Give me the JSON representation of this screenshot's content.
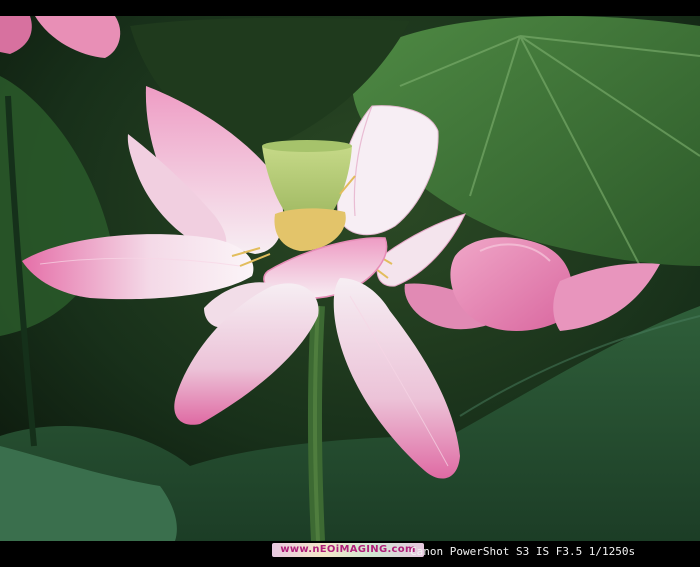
{
  "image": {
    "subject": "lotus-flower-photo",
    "colors": {
      "background_dark": "#12200f",
      "leaf_green": "#3f6e3a",
      "petal_pink": "#e996bd",
      "petal_white": "#f6eef3",
      "seed_pod": "#b9d07a",
      "stamen_yellow": "#e3c46a"
    }
  },
  "watermark": {
    "site": "www.nEOiMAGING.com"
  },
  "caption": {
    "camera_info": "Canon PowerShot S3 IS F3.5 1/1250s"
  }
}
